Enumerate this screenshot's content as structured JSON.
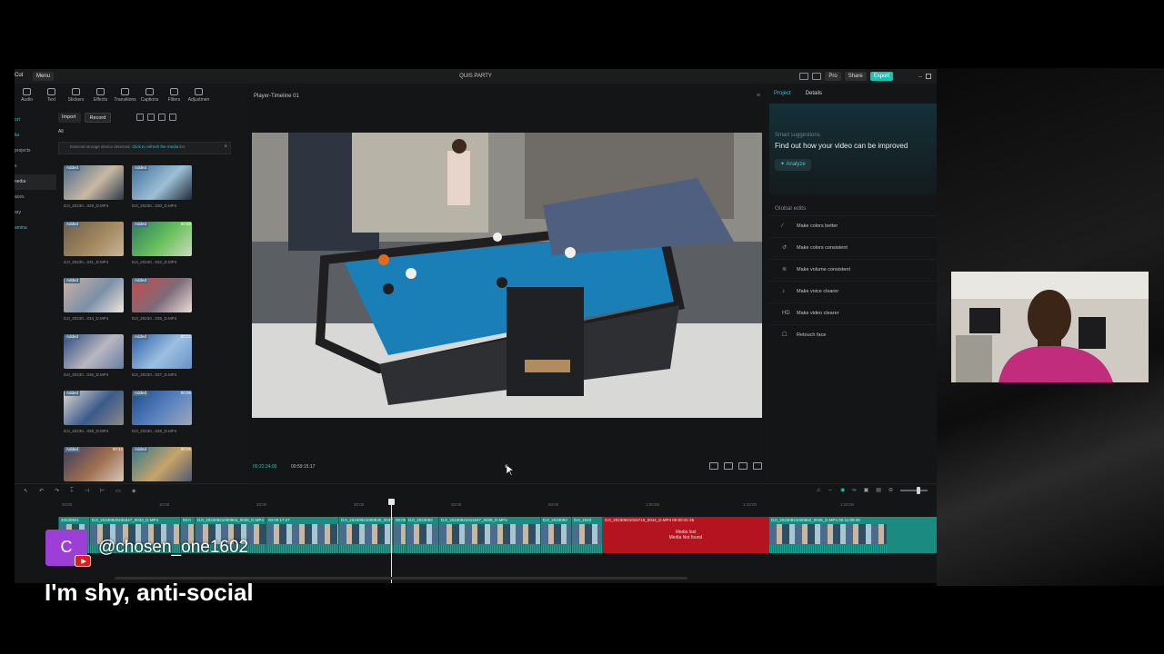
{
  "app": {
    "logo_text": "Cut",
    "menu_label": "Menu",
    "window_title": "QUIS PARTY",
    "pro_label": "Pro",
    "share_label": "Share",
    "export_label": "Export"
  },
  "toolbar": {
    "tools": [
      {
        "label": "Audio"
      },
      {
        "label": "Text"
      },
      {
        "label": "Stickers"
      },
      {
        "label": "Effects"
      },
      {
        "label": "Transitions"
      },
      {
        "label": "Captions"
      },
      {
        "label": "Filters"
      },
      {
        "label": "Adjustmen"
      }
    ]
  },
  "left_nav": {
    "items": [
      {
        "label": "ort"
      },
      {
        "label": "lia"
      },
      {
        "label": "projects"
      },
      {
        "label": "s"
      },
      {
        "label": "nedia"
      },
      {
        "label": "aces"
      },
      {
        "label": "ary"
      },
      {
        "label": "amina"
      }
    ]
  },
  "media": {
    "import_label": "Import",
    "record_label": "Record",
    "filter_all": "All",
    "alert_text": "External storage device detected.",
    "alert_link": "Click to refresh the media",
    "alert_tail": "list",
    "added_tag": "Added",
    "items": [
      {
        "name": "DJI_20230...029_D.MP4",
        "duration": ""
      },
      {
        "name": "DJI_20230...030_D.MP4",
        "duration": ""
      },
      {
        "name": "DJI_20230...031_D.MP4",
        "duration": ""
      },
      {
        "name": "DJI_20230...032_D.MP4",
        "duration": "00:50"
      },
      {
        "name": "DJI_20230...034_D.MP4",
        "duration": ""
      },
      {
        "name": "DJI_20230...035_D.MP4",
        "duration": ""
      },
      {
        "name": "DJI_20230...036_D.MP4",
        "duration": ""
      },
      {
        "name": "DJI_20230...037_D.MP4",
        "duration": "00:22"
      },
      {
        "name": "DJI_20230...038_D.MP4",
        "duration": ""
      },
      {
        "name": "DJI_20230...039_D.MP4",
        "duration": "00:06"
      },
      {
        "name": "",
        "duration": "00:12"
      },
      {
        "name": "",
        "duration": "00:06"
      }
    ]
  },
  "player": {
    "title": "Player-Timeline 01",
    "current_time": "00:22:24:05",
    "total_time": "00:59:15:17"
  },
  "right_panel": {
    "tab_project": "Project",
    "tab_details": "Details",
    "smart_title": "Smart suggestions",
    "smart_headline": "Find out how your video can be improved",
    "analyze_label": "Analyze",
    "global_edits_title": "Global edits",
    "edits": [
      {
        "label": "Make colors better",
        "icon": "wand-icon"
      },
      {
        "label": "Make colors consistent",
        "icon": "palette-icon"
      },
      {
        "label": "Make volume consistent",
        "icon": "volume-icon"
      },
      {
        "label": "Make voice clearer",
        "icon": "voice-icon"
      },
      {
        "label": "Make video clearer",
        "icon": "hd-icon"
      },
      {
        "label": "Retouch face",
        "icon": "face-icon"
      }
    ]
  },
  "timeline": {
    "ruler": [
      "00:00",
      "10:00",
      "20:00",
      "30:00",
      "40:00",
      "50:00",
      "1:00:00",
      "1:10:00",
      "1:20:00",
      "1:30:00"
    ],
    "clips": [
      {
        "label": "20230921"
      },
      {
        "label": "DJI_20230920235347_0033_D.MP4"
      },
      {
        "label": "00:0"
      },
      {
        "label": "DJI_20230921000804_0036_D.MP4"
      },
      {
        "label": "00:00:17:27"
      },
      {
        "label": "DJI_20230921000830_0037_D.MP4"
      },
      {
        "label": "00:05"
      },
      {
        "label": "DJI_2023092"
      },
      {
        "label": "DJI_20230921011637_0039_D.MP4"
      },
      {
        "label": "DJI_2023092"
      },
      {
        "label": "DJI_2023"
      },
      {
        "label": "DJI_20230921015716_0044_D.MP4  00:00:31:25",
        "missing": true,
        "missing_line1": "Media lost",
        "missing_line2": "Media Not found"
      },
      {
        "label": "DJI_20230921020652_0045_D.MP4  00:11:09:28"
      }
    ]
  },
  "overlay": {
    "channel_initial": "C",
    "channel_name": "@chosen_one1602",
    "caption": "I'm shy, anti-social"
  }
}
